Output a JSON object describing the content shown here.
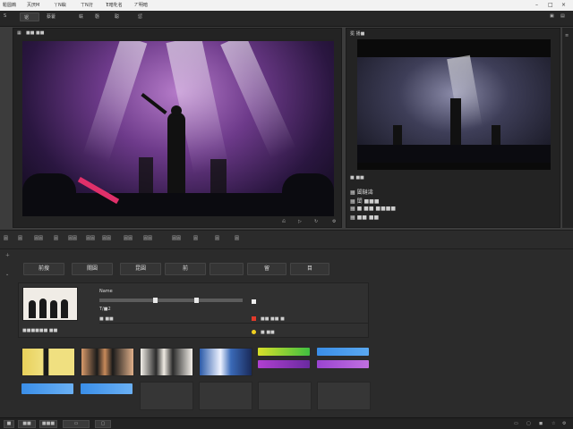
{
  "menu": [
    "鬆圆鷓",
    "灭厌M",
    "丫Ν嶼",
    "丅Ν洐",
    "Έ暗牝名",
    "丆明暗"
  ],
  "toolbar": {
    "tabs": [
      "S",
      "锯",
      "蔡藿",
      "蚨",
      "磬",
      "聪",
      "愆"
    ],
    "left_label": "砺",
    "right_icons": [
      "▣",
      "▤"
    ]
  },
  "source_panel": {
    "tab_label": "■■ ■■",
    "tab_icon": "▦"
  },
  "program_panel": {
    "tab_label": "冕 播■",
    "rows": [
      {
        "icon": "▦",
        "label": "闔韃濤"
      },
      {
        "icon": "▦",
        "label": "閨 ■■■"
      },
      {
        "icon": "▦",
        "label": "■ ■■ ■■■■"
      },
      {
        "icon": "▦",
        "label": "■■ ■■"
      },
      {
        "icon": "▦",
        "label": "■■"
      }
    ],
    "section_label": "■ ■■"
  },
  "bottom_toolbar": [
    "圓",
    "圓",
    "圓圓",
    "圓",
    "圓圓",
    "圓圓",
    "圓圓",
    "圓圓",
    "圓圓",
    "圓圓",
    "圓",
    "圓",
    "圓",
    "圓",
    "圓",
    "圓"
  ],
  "bottom_buttons": [
    "前搜",
    "關圓",
    "昆圓",
    "前",
    "",
    "留",
    "目"
  ],
  "clip": {
    "title": "Name",
    "label_under": "■■■■■■ ■■",
    "sub1": "T/■2",
    "sub2": "■ ■■",
    "red_label": "■■ ■■ ■",
    "yellow_label": "■ ■■"
  },
  "swatches": {
    "white": "#eeeeee",
    "red": "#e23a2a",
    "yellow": "#f0d020",
    "gradient_yellow_green": "#d8e02a",
    "gradient_purple": "#9a44d0",
    "blue": "#3a8ee8"
  },
  "status": {
    "items": [
      "■",
      "■■",
      "■■■",
      "▭",
      "▢"
    ],
    "right_icons": [
      "▭",
      "▢",
      "◼",
      "☆",
      "⚙"
    ]
  }
}
